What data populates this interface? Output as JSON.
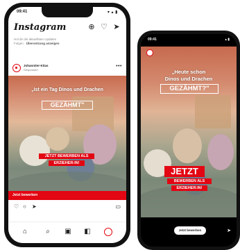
{
  "feed": {
    "status_time": "09:41",
    "status_signal": "▾ ▴ ▮",
    "app_logo": "Instagram",
    "notice_line1": "Hol dir die aktuellsten Updates",
    "notice_line2_prefix": "Folgen · ",
    "notice_line2_bold": "Übersetzung anzeigen",
    "account_name": "Johanniter-Kitas",
    "sponsored": "Gesponsert",
    "cta_bar": "Jetzt bewerben",
    "ad": {
      "headline": "„Ist ein Tag Dinos und Drachen",
      "gez": "GEZÄHMT\"",
      "box1": "JETZT BEWERBEN ALS",
      "box2": "ERZIEHER:IN!"
    }
  },
  "story": {
    "status_time": "09:41",
    "status_signal": "▴ ▮",
    "ad": {
      "headline_1": "„Heute schon",
      "headline_2": "Dinos und Drachen",
      "gez": "GEZÄHMT?\"",
      "jetzt": "JETZT",
      "box1": "BEWERBEN ALS",
      "box2": "ERZIEHER:IN!"
    },
    "cta": "Jetzt bewerben"
  },
  "colors": {
    "brand_red": "#e30613"
  }
}
